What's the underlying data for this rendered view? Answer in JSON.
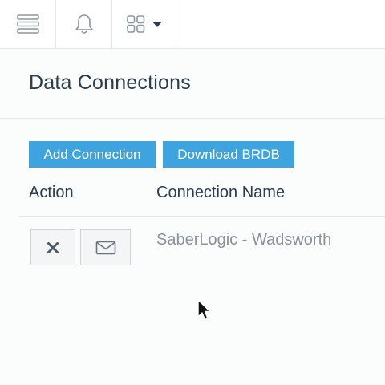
{
  "topbar": {
    "items": [
      {
        "icon": "hamburger-menu-icon"
      },
      {
        "icon": "bell-icon"
      },
      {
        "icon": "apps-grid-icon",
        "dropdown": true
      }
    ]
  },
  "page": {
    "title": "Data Connections"
  },
  "actions": {
    "add_connection_label": "Add Connection",
    "download_brdb_label": "Download BRDB"
  },
  "table": {
    "columns": [
      "Action",
      "Connection Name"
    ],
    "rows": [
      {
        "actions": [
          "close-icon",
          "envelope-icon"
        ],
        "connection_name": "SaberLogic - Wadsworth"
      }
    ]
  },
  "colors": {
    "primary_button": "#3ea4e0",
    "title_text": "#2a3c4e",
    "muted_text": "#8a939b",
    "icon": "#8d969e"
  }
}
